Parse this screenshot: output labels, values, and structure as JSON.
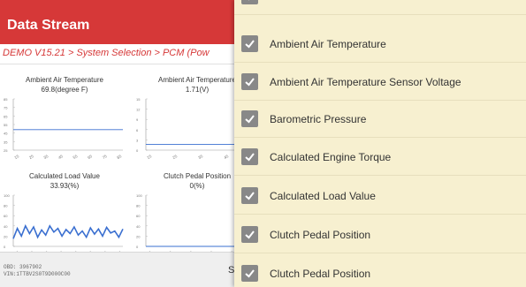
{
  "header": {
    "title": "Data Stream"
  },
  "breadcrumb": "DEMO V15.21 > System Selection > PCM (Pow",
  "charts": [
    {
      "name": "Ambient Air Temperature",
      "value": "69.8(degree F)",
      "y_ticks": [
        "85",
        "75",
        "65",
        "55",
        "45",
        "35",
        "25"
      ],
      "x_ticks": [
        "15",
        "25",
        "35",
        "45",
        "55",
        "65",
        "75",
        "85"
      ]
    },
    {
      "name": "Ambient Air Temperature",
      "value": "1.71(V)",
      "y_ticks": [
        "15",
        "12",
        "9",
        "6",
        "3",
        "0"
      ],
      "x_ticks": [
        "15",
        "25",
        "35",
        "45",
        "55"
      ]
    },
    {
      "name": "Calculated Load Value",
      "value": "33.93(%)",
      "y_ticks": [
        "100",
        "80",
        "60",
        "40",
        "20",
        "0"
      ],
      "x_ticks": [
        "15",
        "25",
        "35",
        "45",
        "55",
        "65",
        "75",
        "85"
      ]
    },
    {
      "name": "Clutch Pedal Position",
      "value": "0(%)",
      "y_ticks": [
        "100",
        "80",
        "60",
        "40",
        "20",
        "0"
      ],
      "x_ticks": [
        "15",
        "25",
        "35",
        "45",
        "55",
        "65"
      ]
    }
  ],
  "chart_data": [
    {
      "type": "line",
      "title": "Ambient Air Temperature",
      "ylim": [
        0,
        100
      ],
      "series": [
        {
          "values": [
            40,
            40,
            40,
            40,
            40,
            40,
            40,
            40,
            40,
            40,
            40,
            40,
            40,
            40,
            40,
            40,
            40,
            40,
            40,
            40
          ]
        }
      ]
    },
    {
      "type": "line",
      "title": "Ambient Air Temperature",
      "ylim": [
        0,
        15
      ],
      "series": [
        {
          "values": [
            1.71,
            1.71,
            1.71,
            1.71,
            1.71,
            1.71,
            1.71,
            1.71,
            1.71,
            1.71,
            1.71,
            1.71
          ]
        }
      ]
    },
    {
      "type": "line",
      "title": "Calculated Load Value",
      "ylim": [
        0,
        100
      ],
      "series": [
        {
          "values": [
            15,
            35,
            20,
            40,
            25,
            38,
            18,
            32,
            22,
            40,
            28,
            35,
            20,
            33,
            25,
            38,
            22,
            30,
            18,
            36,
            24,
            34,
            20,
            37,
            26,
            30,
            18,
            34
          ]
        }
      ]
    },
    {
      "type": "line",
      "title": "Clutch Pedal Position",
      "ylim": [
        0,
        100
      ],
      "series": [
        {
          "values": [
            0,
            0,
            0,
            0,
            0,
            0,
            0,
            0,
            0,
            0,
            0,
            0
          ]
        }
      ]
    }
  ],
  "footer": {
    "line1": "OBD: 3967902",
    "line2": "VIN:1TTBV2S0T9D000C00",
    "save_partial": "Sa"
  },
  "options": [
    {
      "label": "",
      "checked": true
    },
    {
      "label": "Ambient Air Temperature",
      "checked": true
    },
    {
      "label": "Ambient Air Temperature Sensor Voltage",
      "checked": true
    },
    {
      "label": "Barometric Pressure",
      "checked": true
    },
    {
      "label": "Calculated Engine Torque",
      "checked": true
    },
    {
      "label": "Calculated Load Value",
      "checked": true
    },
    {
      "label": "Clutch Pedal Position",
      "checked": true
    },
    {
      "label": "Clutch Pedal Position",
      "checked": true
    }
  ],
  "colors": {
    "header": "#d63838",
    "line": "#3a6fd0",
    "overlay": "#f7f0d0",
    "checkbox": "#888888"
  },
  "icons": {
    "checkbox": "checkmark-icon"
  }
}
